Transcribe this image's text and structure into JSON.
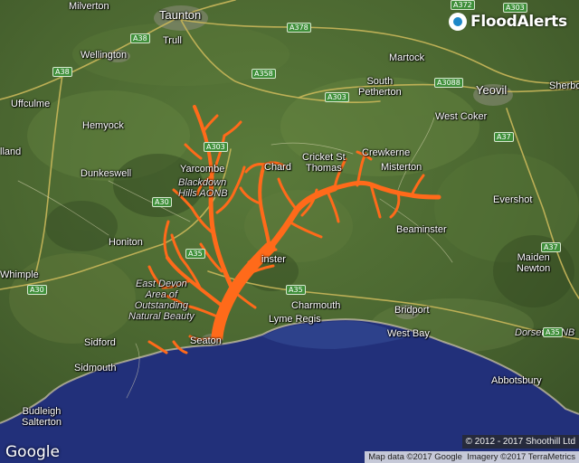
{
  "brand": {
    "name": "FloodAlerts"
  },
  "colors": {
    "flood_area": "#ff6a1a",
    "sea": "#1f2f7a",
    "land": "#4e6b32"
  },
  "places": [
    {
      "id": "milverton",
      "name": "Milverton"
    },
    {
      "id": "taunton",
      "name": "Taunton"
    },
    {
      "id": "trull",
      "name": "Trull"
    },
    {
      "id": "wellington",
      "name": "Wellington"
    },
    {
      "id": "martock",
      "name": "Martock"
    },
    {
      "id": "south-petherton",
      "name": "South\nPetherton"
    },
    {
      "id": "yeovil",
      "name": "Yeovil"
    },
    {
      "id": "sherborne",
      "name": "Sherbo"
    },
    {
      "id": "uffculme",
      "name": "Uffculme"
    },
    {
      "id": "hemyock",
      "name": "Hemyock"
    },
    {
      "id": "west-coker",
      "name": "West Coker"
    },
    {
      "id": "hillmorton",
      "name": "lland"
    },
    {
      "id": "crewkerne",
      "name": "Crewkerne"
    },
    {
      "id": "cricket-st-thomas",
      "name": "Cricket St\nThomas"
    },
    {
      "id": "chard",
      "name": "Chard"
    },
    {
      "id": "misterton",
      "name": "Misterton"
    },
    {
      "id": "yarcombe",
      "name": "Yarcombe"
    },
    {
      "id": "dunkeswell",
      "name": "Dunkeswell"
    },
    {
      "id": "evershot",
      "name": "Evershot"
    },
    {
      "id": "honiton",
      "name": "Honiton"
    },
    {
      "id": "beaminster",
      "name": "Beaminster"
    },
    {
      "id": "axminster",
      "name": "inster"
    },
    {
      "id": "maiden-newton",
      "name": "Maiden\nNewton"
    },
    {
      "id": "whimple",
      "name": "Whimple"
    },
    {
      "id": "charmouth",
      "name": "Charmouth"
    },
    {
      "id": "bridport",
      "name": "Bridport"
    },
    {
      "id": "lyme-regis",
      "name": "Lyme Regis"
    },
    {
      "id": "sidford",
      "name": "Sidford"
    },
    {
      "id": "seaton",
      "name": "Seaton"
    },
    {
      "id": "west-bay",
      "name": "West Bay"
    },
    {
      "id": "sidmouth",
      "name": "Sidmouth"
    },
    {
      "id": "abbotsbury",
      "name": "Abbotsbury"
    },
    {
      "id": "budleigh-salterton",
      "name": "Budleigh\nSalterton"
    }
  ],
  "areas": [
    {
      "id": "blackdown-hills",
      "name": "Blackdown\nHills AONB"
    },
    {
      "id": "east-devon",
      "name": "East Devon\nArea of\nOutstanding\nNatural Beauty"
    },
    {
      "id": "dorset",
      "name": "Dorset AONB"
    }
  ],
  "roads": [
    {
      "id": "a372",
      "name": "A372"
    },
    {
      "id": "a38-north",
      "name": "A38"
    },
    {
      "id": "a378",
      "name": "A378"
    },
    {
      "id": "a38-west",
      "name": "A38"
    },
    {
      "id": "a358",
      "name": "A358"
    },
    {
      "id": "a303-top",
      "name": "A303"
    },
    {
      "id": "a303-mid",
      "name": "A303"
    },
    {
      "id": "a3088",
      "name": "A3088"
    },
    {
      "id": "a37-north",
      "name": "A37"
    },
    {
      "id": "a30-mid",
      "name": "A30"
    },
    {
      "id": "a35-mid",
      "name": "A35"
    },
    {
      "id": "a37-south",
      "name": "A37"
    },
    {
      "id": "a30-west",
      "name": "A30"
    },
    {
      "id": "a35-east",
      "name": "A35"
    },
    {
      "id": "a303-small",
      "name": "A303"
    },
    {
      "id": "a35-west",
      "name": "A35"
    }
  ],
  "footer": {
    "google": "Google",
    "copyright": "© 2012 - 2017 Shoothill Ltd",
    "map_data": "Map data ©2017 Google",
    "imagery": "Imagery ©2017 TerraMetrics"
  }
}
